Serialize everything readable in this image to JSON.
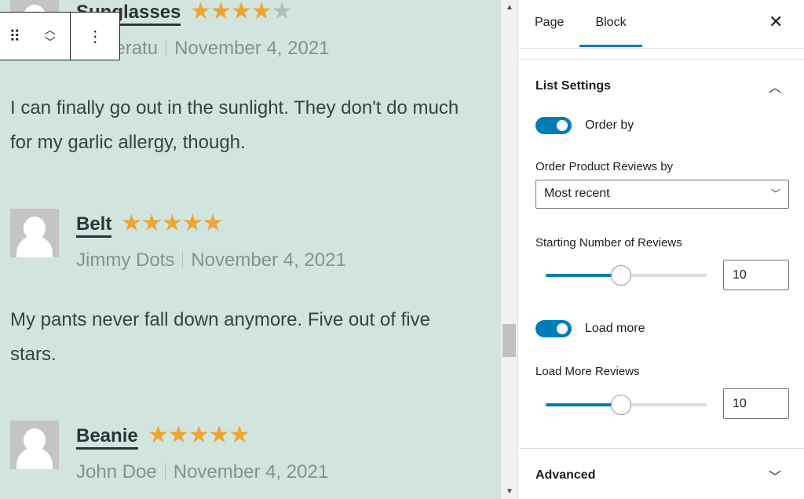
{
  "reviews": [
    {
      "title": "Sunglasses",
      "rating": 4,
      "author": "Nosferatu",
      "date": "November 4, 2021",
      "text": "I can finally go out in the sunlight. They don't do much for my garlic allergy, though."
    },
    {
      "title": "Belt",
      "rating": 5,
      "author": "Jimmy Dots",
      "date": "November 4, 2021",
      "text": "My pants never fall down anymore. Five out of five stars."
    },
    {
      "title": "Beanie",
      "rating": 5,
      "author": "John Doe",
      "date": "November 4, 2021",
      "text": ""
    }
  ],
  "toolbar": {
    "drag_icon": "drag-handle-icon",
    "move_icon": "chevron-up-down-icon",
    "options_icon": "more-vertical-icon"
  },
  "sidebar": {
    "tabs": [
      {
        "label": "Page"
      },
      {
        "label": "Block",
        "active": true
      }
    ],
    "list_settings": {
      "title": "List Settings",
      "order_by_label": "Order by",
      "order_by_on": true,
      "order_reviews_label": "Order Product Reviews by",
      "order_reviews_value": "Most recent",
      "starting_label": "Starting Number of Reviews",
      "starting_value": "10",
      "starting_slider_fraction": 0.47,
      "load_more_label": "Load more",
      "load_more_on": true,
      "load_more_reviews_label": "Load More Reviews",
      "load_more_reviews_value": "10",
      "load_more_slider_fraction": 0.47
    },
    "advanced": {
      "title": "Advanced"
    }
  },
  "colors": {
    "accent": "#007cba",
    "star": "#eda533",
    "canvas": "#d1e4de"
  }
}
